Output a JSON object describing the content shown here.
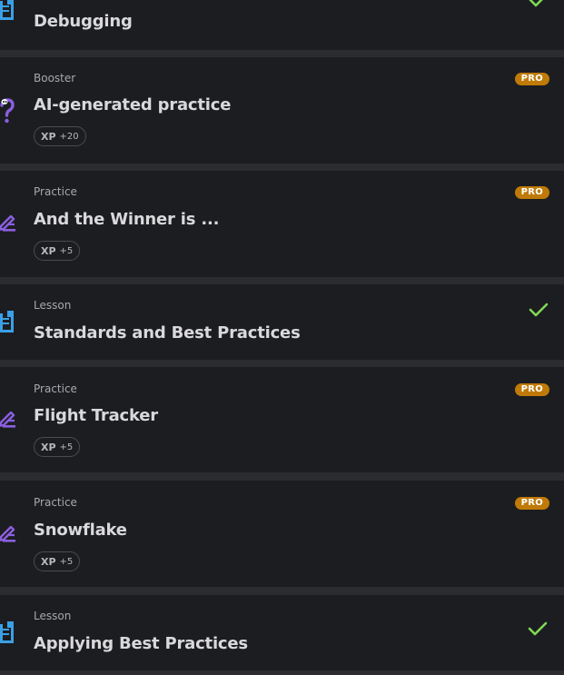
{
  "colors": {
    "lesson_icon": "#3aa0e6",
    "practice_icon": "#8b5fe0",
    "pro_badge": "#c07a08",
    "check": "#7fd957"
  },
  "items": [
    {
      "kind": "",
      "title": "Debugging",
      "status": "completed",
      "icon": "lesson-doc-icon"
    },
    {
      "kind": "Booster",
      "title": "AI-generated practice",
      "badge": "PRO",
      "xp_label": "XP",
      "xp_value": "+20",
      "icon": "question-mark-icon"
    },
    {
      "kind": "Practice",
      "title": "And the Winner is ...",
      "badge": "PRO",
      "xp_label": "XP",
      "xp_value": "+5",
      "icon": "pencil-icon"
    },
    {
      "kind": "Lesson",
      "title": "Standards and Best Practices",
      "status": "completed",
      "icon": "lesson-doc-icon"
    },
    {
      "kind": "Practice",
      "title": "Flight Tracker",
      "badge": "PRO",
      "xp_label": "XP",
      "xp_value": "+5",
      "icon": "pencil-icon"
    },
    {
      "kind": "Practice",
      "title": "Snowflake",
      "badge": "PRO",
      "xp_label": "XP",
      "xp_value": "+5",
      "icon": "pencil-icon"
    },
    {
      "kind": "Lesson",
      "title": "Applying Best Practices",
      "status": "completed",
      "icon": "lesson-doc-icon"
    }
  ]
}
